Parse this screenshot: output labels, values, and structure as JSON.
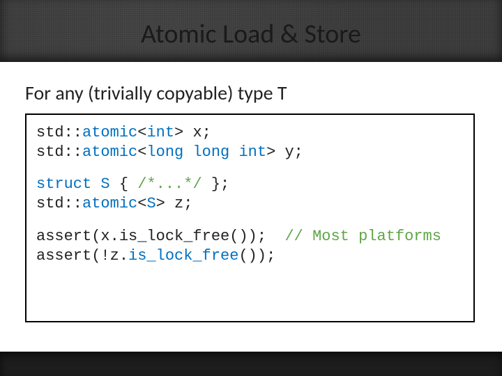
{
  "title": "Atomic Load & Store",
  "intro": "For any (trivially copyable) type T",
  "code": {
    "l1": {
      "a": "std::",
      "b": "atomic",
      "c": "<",
      "d": "int",
      "e": "> x;"
    },
    "l2": {
      "a": "std::",
      "b": "atomic",
      "c": "<",
      "d": "long long int",
      "e": "> y;"
    },
    "l3": {
      "a": "struct ",
      "b": "S",
      "c": " { ",
      "d": "/*...*/",
      "e": " };"
    },
    "l4": {
      "a": "std::",
      "b": "atomic",
      "c": "<",
      "d": "S",
      "e": "> z;"
    },
    "l5": {
      "a": "assert(x.is_lock_free());  ",
      "b": "// Most platforms"
    },
    "l6": {
      "a": "assert(!z.",
      "b": "is_lock_free",
      "c": "());"
    }
  }
}
